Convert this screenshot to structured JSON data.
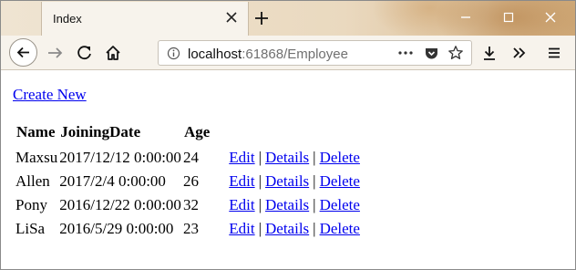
{
  "browser": {
    "tab": {
      "title": "Index"
    },
    "url": {
      "host": "localhost",
      "rest": ":61868/Employee"
    }
  },
  "page": {
    "create_link": "Create New",
    "table": {
      "headers": [
        "Name",
        "JoiningDate",
        "Age",
        ""
      ],
      "rows": [
        {
          "name": "Maxsu",
          "joining": "2017/12/12 0:00:00",
          "age": "24"
        },
        {
          "name": "Allen",
          "joining": "2017/2/4 0:00:00",
          "age": "26"
        },
        {
          "name": "Pony",
          "joining": "2016/12/22 0:00:00",
          "age": "32"
        },
        {
          "name": "LiSa",
          "joining": "2016/5/29 0:00:00",
          "age": "23"
        }
      ],
      "actions": {
        "edit": "Edit",
        "details": "Details",
        "delete": "Delete",
        "separator": "|"
      }
    }
  },
  "colors": {
    "link": "#0000ee",
    "chrome": "#f7f3ec"
  },
  "icons": [
    "close-icon",
    "plus-icon",
    "minimize-icon",
    "maximize-icon",
    "back-icon",
    "forward-icon",
    "reload-icon",
    "home-icon",
    "info-icon",
    "more-icon",
    "pocket-icon",
    "star-icon",
    "download-icon",
    "overflow-icon",
    "menu-icon"
  ]
}
